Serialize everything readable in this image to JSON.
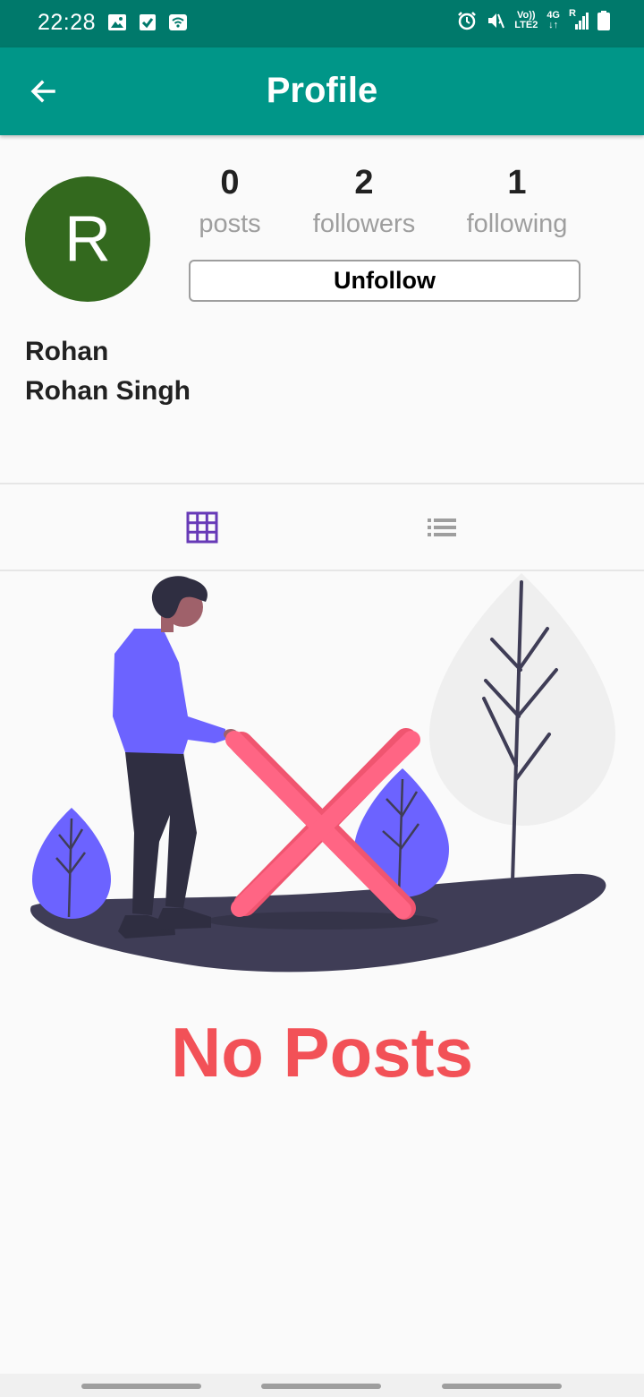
{
  "status_bar": {
    "time": "22:28",
    "network_label": "4G",
    "roaming_label": "R",
    "volte_label": "Vo))",
    "lte_label": "LTE2"
  },
  "app_bar": {
    "title": "Profile",
    "back_icon": "arrow-left-icon"
  },
  "profile": {
    "avatar_initial": "R",
    "avatar_color": "#33691e",
    "username": "Rohan",
    "full_name": "Rohan Singh",
    "stats": [
      {
        "count": "0",
        "label": "posts"
      },
      {
        "count": "2",
        "label": "followers"
      },
      {
        "count": "1",
        "label": "following"
      }
    ],
    "action_button": "Unfollow"
  },
  "tabs": [
    {
      "icon": "grid-icon",
      "active": true,
      "color": "#673ab7"
    },
    {
      "icon": "list-icon",
      "active": false,
      "color": "#9e9e9e"
    }
  ],
  "empty_state": {
    "message": "No Posts",
    "color": "#f25157"
  },
  "colors": {
    "status_bar": "#00796b",
    "app_bar": "#009688",
    "background": "#fafafa"
  }
}
